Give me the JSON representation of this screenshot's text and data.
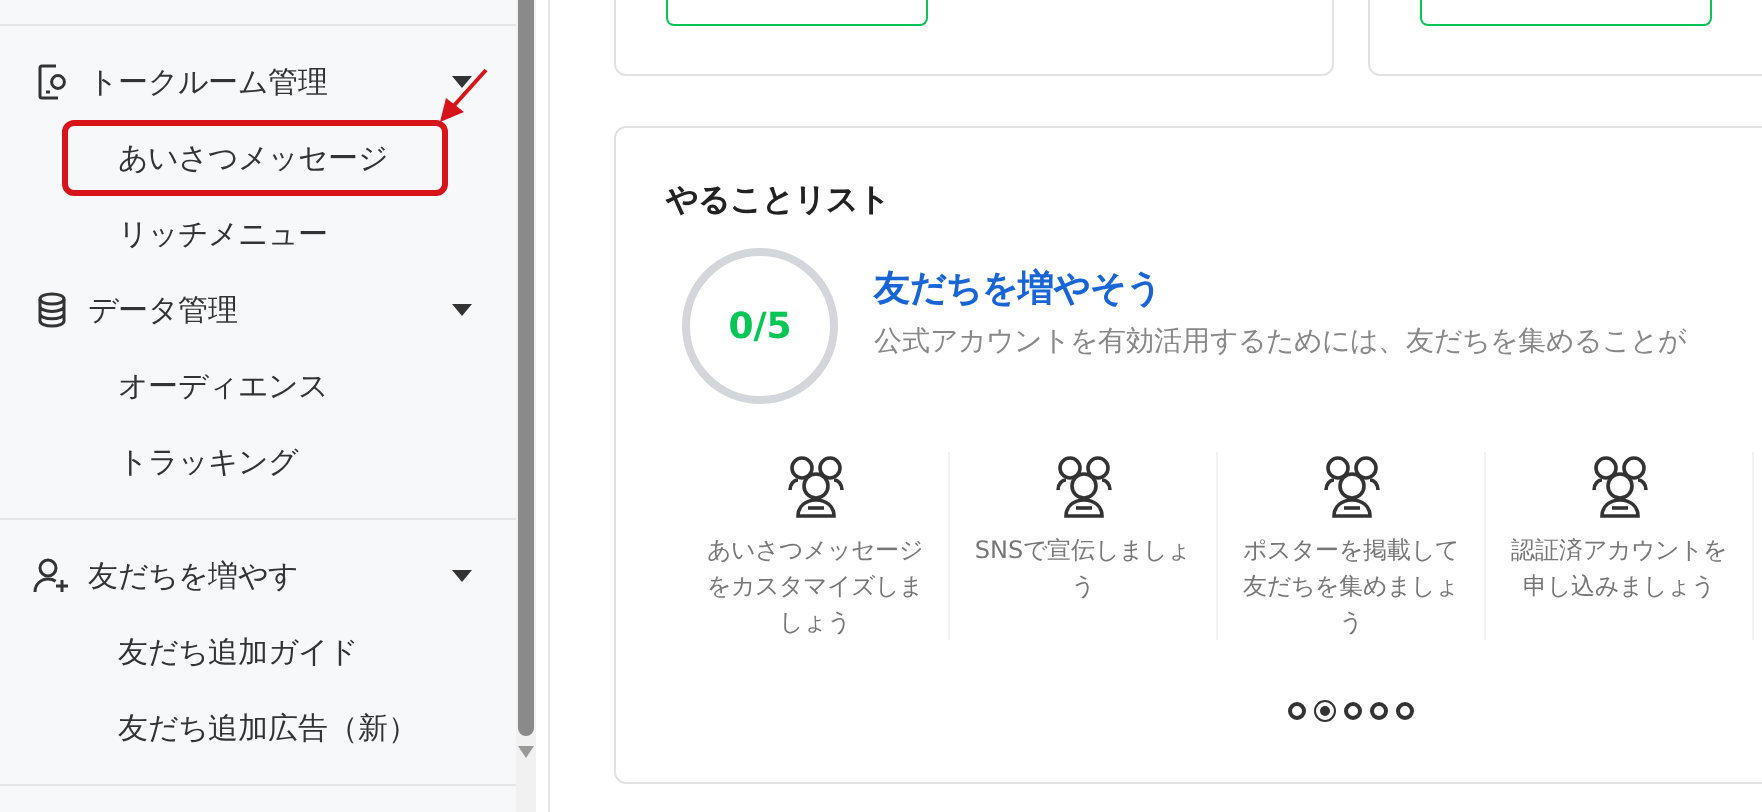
{
  "sidebar": {
    "groups": [
      {
        "kind": "talk",
        "label": "トークルーム管理",
        "expanded": true,
        "items": [
          {
            "label": "あいさつメッセージ",
            "highlighted": true
          },
          {
            "label": "リッチメニュー",
            "highlighted": false
          }
        ]
      },
      {
        "kind": "data",
        "label": "データ管理",
        "expanded": true,
        "items": [
          {
            "label": "オーディエンス",
            "highlighted": false
          },
          {
            "label": "トラッキング",
            "highlighted": false
          }
        ]
      },
      {
        "kind": "friends",
        "label": "友だちを増やす",
        "expanded": true,
        "items": [
          {
            "label": "友だち追加ガイド",
            "highlighted": false
          },
          {
            "label": "友だち追加広告（新）",
            "highlighted": false
          }
        ]
      }
    ]
  },
  "todo": {
    "title": "やることリスト",
    "progress": "0/5",
    "heading": "友だちを増やそう",
    "description": "公式アカウントを有効活用するためには、友だちを集めることが",
    "tasks": [
      {
        "label": "あいさつメッセージをカスタマイズしましょう"
      },
      {
        "label": "SNSで宣伝しましょう"
      },
      {
        "label": "ポスターを掲載して友だちを集めましょう"
      },
      {
        "label": "認証済アカウントを申し込みましょう"
      }
    ],
    "pages": [
      {
        "selected": false
      },
      {
        "selected": true
      },
      {
        "selected": false
      },
      {
        "selected": false
      },
      {
        "selected": false
      }
    ]
  }
}
